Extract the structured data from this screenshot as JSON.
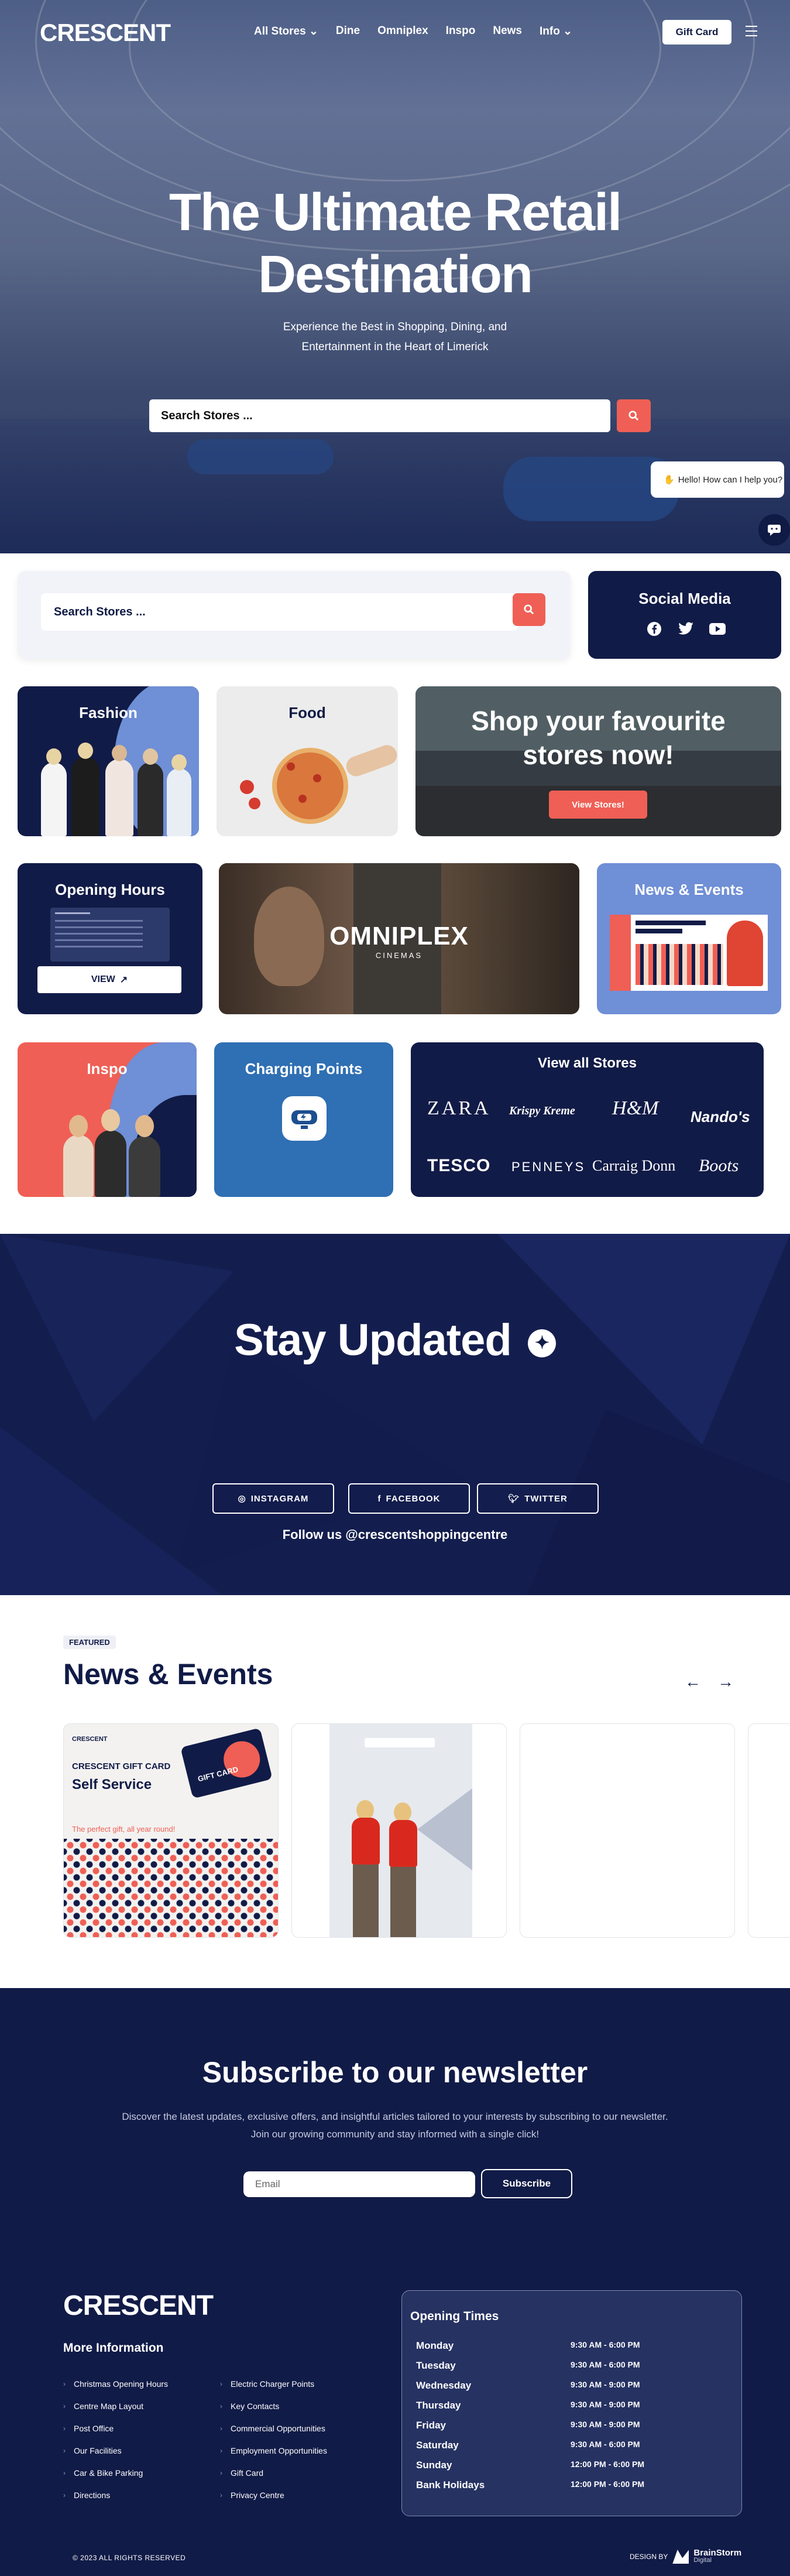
{
  "header": {
    "logo": "CRESCENT",
    "nav": [
      "All Stores",
      "Dine",
      "Omniplex",
      "Inspo",
      "News",
      "Info"
    ],
    "gift_card_button": "Gift Card"
  },
  "hero": {
    "title_line1": "The Ultimate Retail",
    "title_line2": "Destination",
    "subtitle_line1": "Experience the Best in Shopping, Dining, and",
    "subtitle_line2": "Entertainment in the Heart of Limerick",
    "search_placeholder": "Search Stores ...",
    "chat_text": "Hello! How can I help you?"
  },
  "search_section": {
    "search_placeholder": "Search Stores ...",
    "social_title": "Social Media"
  },
  "tiles": {
    "fashion": "Fashion",
    "food": "Food",
    "shop_line1": "Shop your favourite",
    "shop_line2": "stores now!",
    "view_stores": "View Stores!",
    "opening_hours": "Opening Hours",
    "view_button": "VIEW",
    "omniplex": "OMNIPLEX",
    "omniplex_sub": "CINEMAS",
    "news_events": "News & Events",
    "inspo": "Inspo",
    "charging": "Charging Points",
    "view_all_stores": "View all Stores",
    "brands": [
      "ZARA",
      "Krispy Kreme",
      "H&M",
      "Nando's",
      "TESCO",
      "PENNEYS",
      "Carraig Donn",
      "Boots"
    ]
  },
  "stay_updated": {
    "title": "Stay Updated",
    "buttons": [
      "INSTAGRAM",
      "FACEBOOK",
      "TWITTER"
    ],
    "follow": "Follow us @crescentshoppingcentre"
  },
  "news": {
    "badge": "FEATURED",
    "title": "News & Events",
    "card1_logo": "CRESCENT",
    "card1_line1": "CRESCENT GIFT CARD",
    "card1_line2": "Self Service",
    "card1_line3": "The perfect gift, all year round!",
    "card1_giftcard": "GIFT CARD"
  },
  "newsletter": {
    "title": "Subscribe to our newsletter",
    "text_line1": "Discover the latest updates, exclusive offers, and insightful articles tailored to your interests by subscribing to our newsletter.",
    "text_line2": "Join our growing community and stay informed with a single click!",
    "email_placeholder": "Email",
    "subscribe": "Subscribe"
  },
  "footer": {
    "logo": "CRESCENT",
    "more_info": "More Information",
    "links_col1": [
      "Christmas Opening Hours",
      "Centre Map Layout",
      "Post Office",
      "Our Facilities",
      "Car & Bike Parking",
      "Directions"
    ],
    "links_col2": [
      "Electric Charger Points",
      "Key Contacts",
      "Commercial Opportunities",
      "Employment Opportunities",
      "Gift Card",
      "Privacy Centre"
    ],
    "opening_title": "Opening Times",
    "opening": [
      {
        "day": "Monday",
        "hours": "9:30 AM - 6:00 PM"
      },
      {
        "day": "Tuesday",
        "hours": "9:30 AM - 6:00 PM"
      },
      {
        "day": "Wednesday",
        "hours": "9:30 AM - 9:00 PM"
      },
      {
        "day": "Thursday",
        "hours": "9:30 AM - 9:00 PM"
      },
      {
        "day": "Friday",
        "hours": "9:30 AM - 9:00 PM"
      },
      {
        "day": "Saturday",
        "hours": "9:30 AM - 6:00 PM"
      },
      {
        "day": "Sunday",
        "hours": "12:00 PM - 6:00 PM"
      },
      {
        "day": "Bank Holidays",
        "hours": "12:00 PM - 6:00 PM"
      }
    ],
    "copyright": "© 2023 ALL RIGHTS RESERVED",
    "design_by": "DESIGN BY",
    "designer": "BrainStorm",
    "designer_sub": "Digital"
  },
  "colors": {
    "navy": "#111b47",
    "coral": "#ef5f55",
    "periwinkle": "#6f8fd6",
    "blue": "#2f6fb3"
  }
}
